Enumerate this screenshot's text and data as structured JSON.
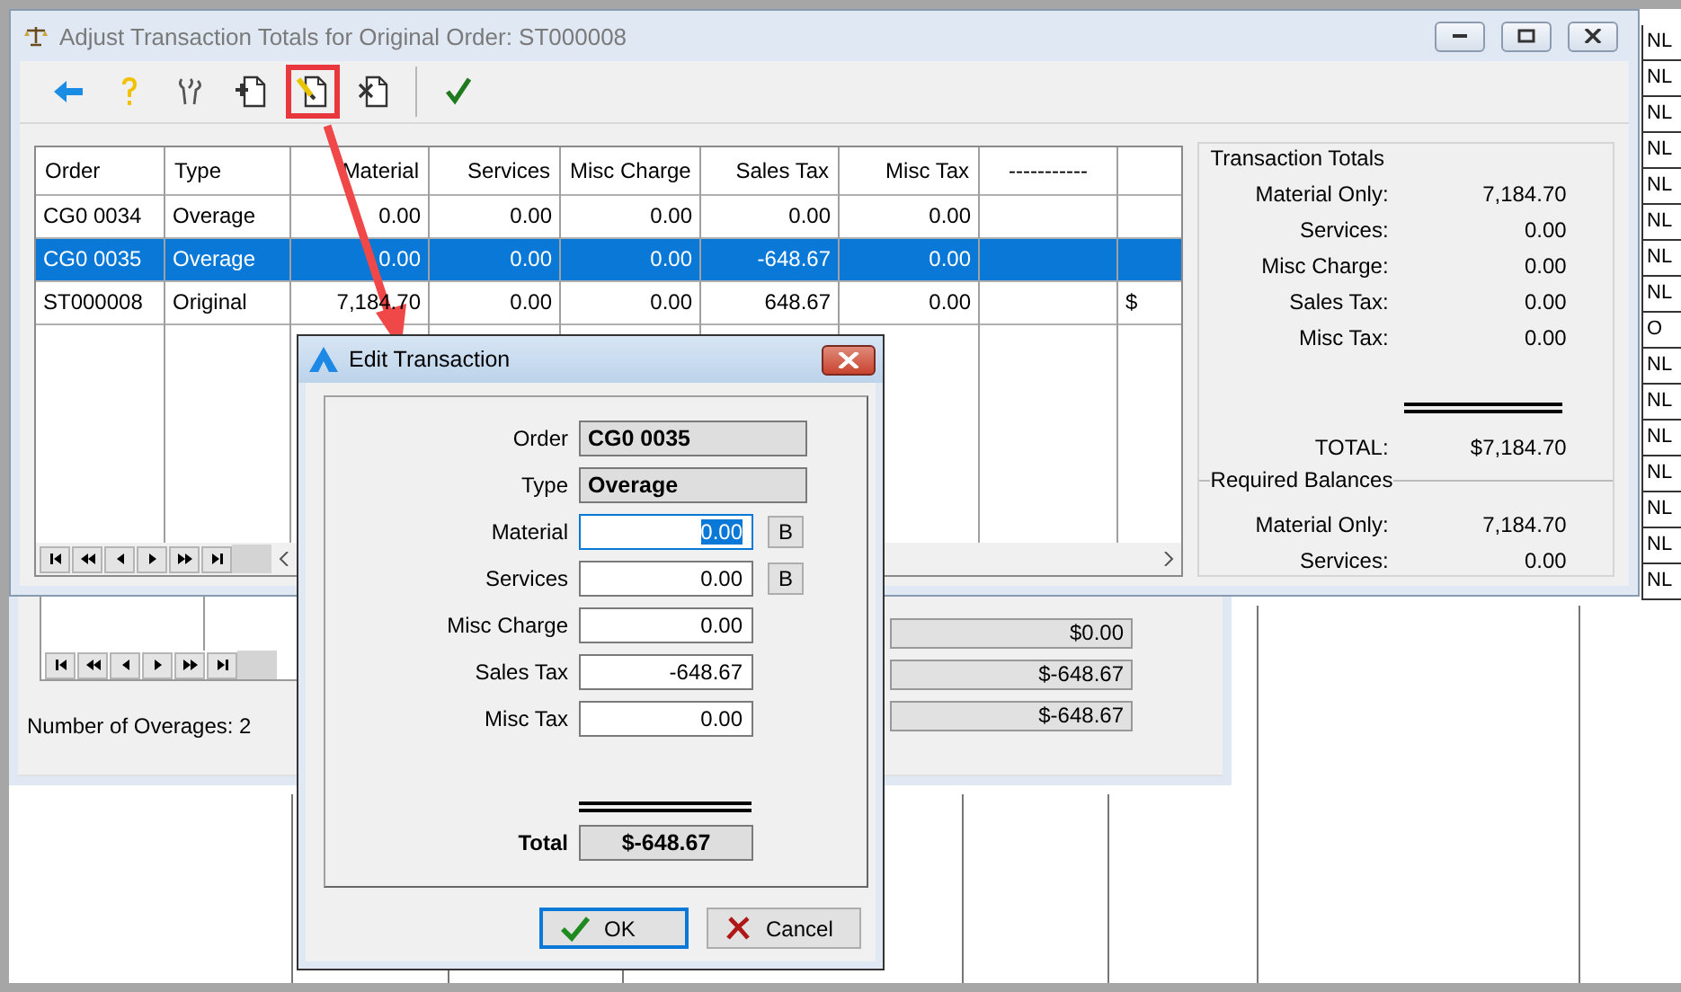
{
  "main_window": {
    "title": "Adjust Transaction Totals for Original Order: ST000008",
    "active": false,
    "toolbar": [
      {
        "kind": "back",
        "highlighted": false
      },
      {
        "kind": "help",
        "highlighted": false
      },
      {
        "kind": "tools",
        "highlighted": false
      },
      {
        "kind": "add",
        "highlighted": false
      },
      {
        "kind": "edit",
        "highlighted": true
      },
      {
        "kind": "delete",
        "highlighted": false
      },
      {
        "kind": "separator"
      },
      {
        "kind": "accept",
        "highlighted": false
      }
    ],
    "grid": {
      "columns": [
        {
          "label": "Order",
          "kind": "text"
        },
        {
          "label": "Type",
          "kind": "text"
        },
        {
          "label": "Material",
          "kind": "number"
        },
        {
          "label": "Services",
          "kind": "number"
        },
        {
          "label": "Misc Charge",
          "kind": "number"
        },
        {
          "label": "Sales Tax",
          "kind": "number"
        },
        {
          "label": "Misc Tax",
          "kind": "number"
        },
        {
          "label": "-----------",
          "kind": "placeholder"
        }
      ],
      "rows": [
        {
          "cells": [
            "CG0 0034",
            "Overage",
            "0.00",
            "0.00",
            "0.00",
            "0.00",
            "0.00"
          ],
          "selected": false
        },
        {
          "cells": [
            "CG0 0035",
            "Overage",
            "0.00",
            "0.00",
            "0.00",
            "-648.67",
            "0.00"
          ],
          "selected": true
        },
        {
          "cells": [
            "ST000008",
            "Original",
            "7,184.70",
            "0.00",
            "0.00",
            "648.67",
            "0.00",
            "",
            "$"
          ],
          "selected": false
        }
      ]
    },
    "transaction_totals": {
      "title": "Transaction Totals",
      "lines": [
        {
          "label": "Material Only:",
          "value": "7,184.70"
        },
        {
          "label": "Services:",
          "value": "0.00"
        },
        {
          "label": "Misc Charge:",
          "value": "0.00"
        },
        {
          "label": "Sales Tax:",
          "value": "0.00"
        },
        {
          "label": "Misc Tax:",
          "value": "0.00"
        }
      ],
      "total": {
        "label": "TOTAL:",
        "value": "$7,184.70"
      }
    },
    "required_balances": {
      "title": "Required Balances",
      "lines": [
        {
          "label": "Material Only:",
          "value": "7,184.70"
        },
        {
          "label": "Services:",
          "value": "0.00"
        }
      ]
    }
  },
  "background_window": {
    "summary_fields": [
      "$0.00",
      "$-648.67",
      "$-648.67"
    ],
    "overage_count": "Number of Overages: 2"
  },
  "edit_dialog": {
    "title": "Edit Transaction",
    "active": true,
    "readonly_fields": [
      {
        "label": "Order",
        "value": "CG0 0035"
      },
      {
        "label": "Type",
        "value": "Overage"
      }
    ],
    "fields": [
      {
        "label": "Material",
        "value": "0.00",
        "focused": true,
        "button": "B"
      },
      {
        "label": "Services",
        "value": "0.00",
        "focused": false,
        "button": "B"
      },
      {
        "label": "Misc Charge",
        "value": "0.00",
        "focused": false
      },
      {
        "label": "Sales Tax",
        "value": "-648.67",
        "focused": false
      },
      {
        "label": "Misc Tax",
        "value": "0.00",
        "focused": false
      }
    ],
    "total": {
      "label": "Total",
      "value": "$-648.67"
    },
    "buttons": [
      {
        "label": "OK",
        "kind": "ok",
        "default": true
      },
      {
        "label": "Cancel",
        "kind": "cancel",
        "default": false
      }
    ]
  },
  "background_cells": [
    "NL",
    "NL",
    "NL",
    "NL",
    "NL",
    "NL",
    "NL",
    "NL",
    "O",
    "NL",
    "NL",
    "NL",
    "NL",
    "NL",
    "NL",
    "NL"
  ]
}
